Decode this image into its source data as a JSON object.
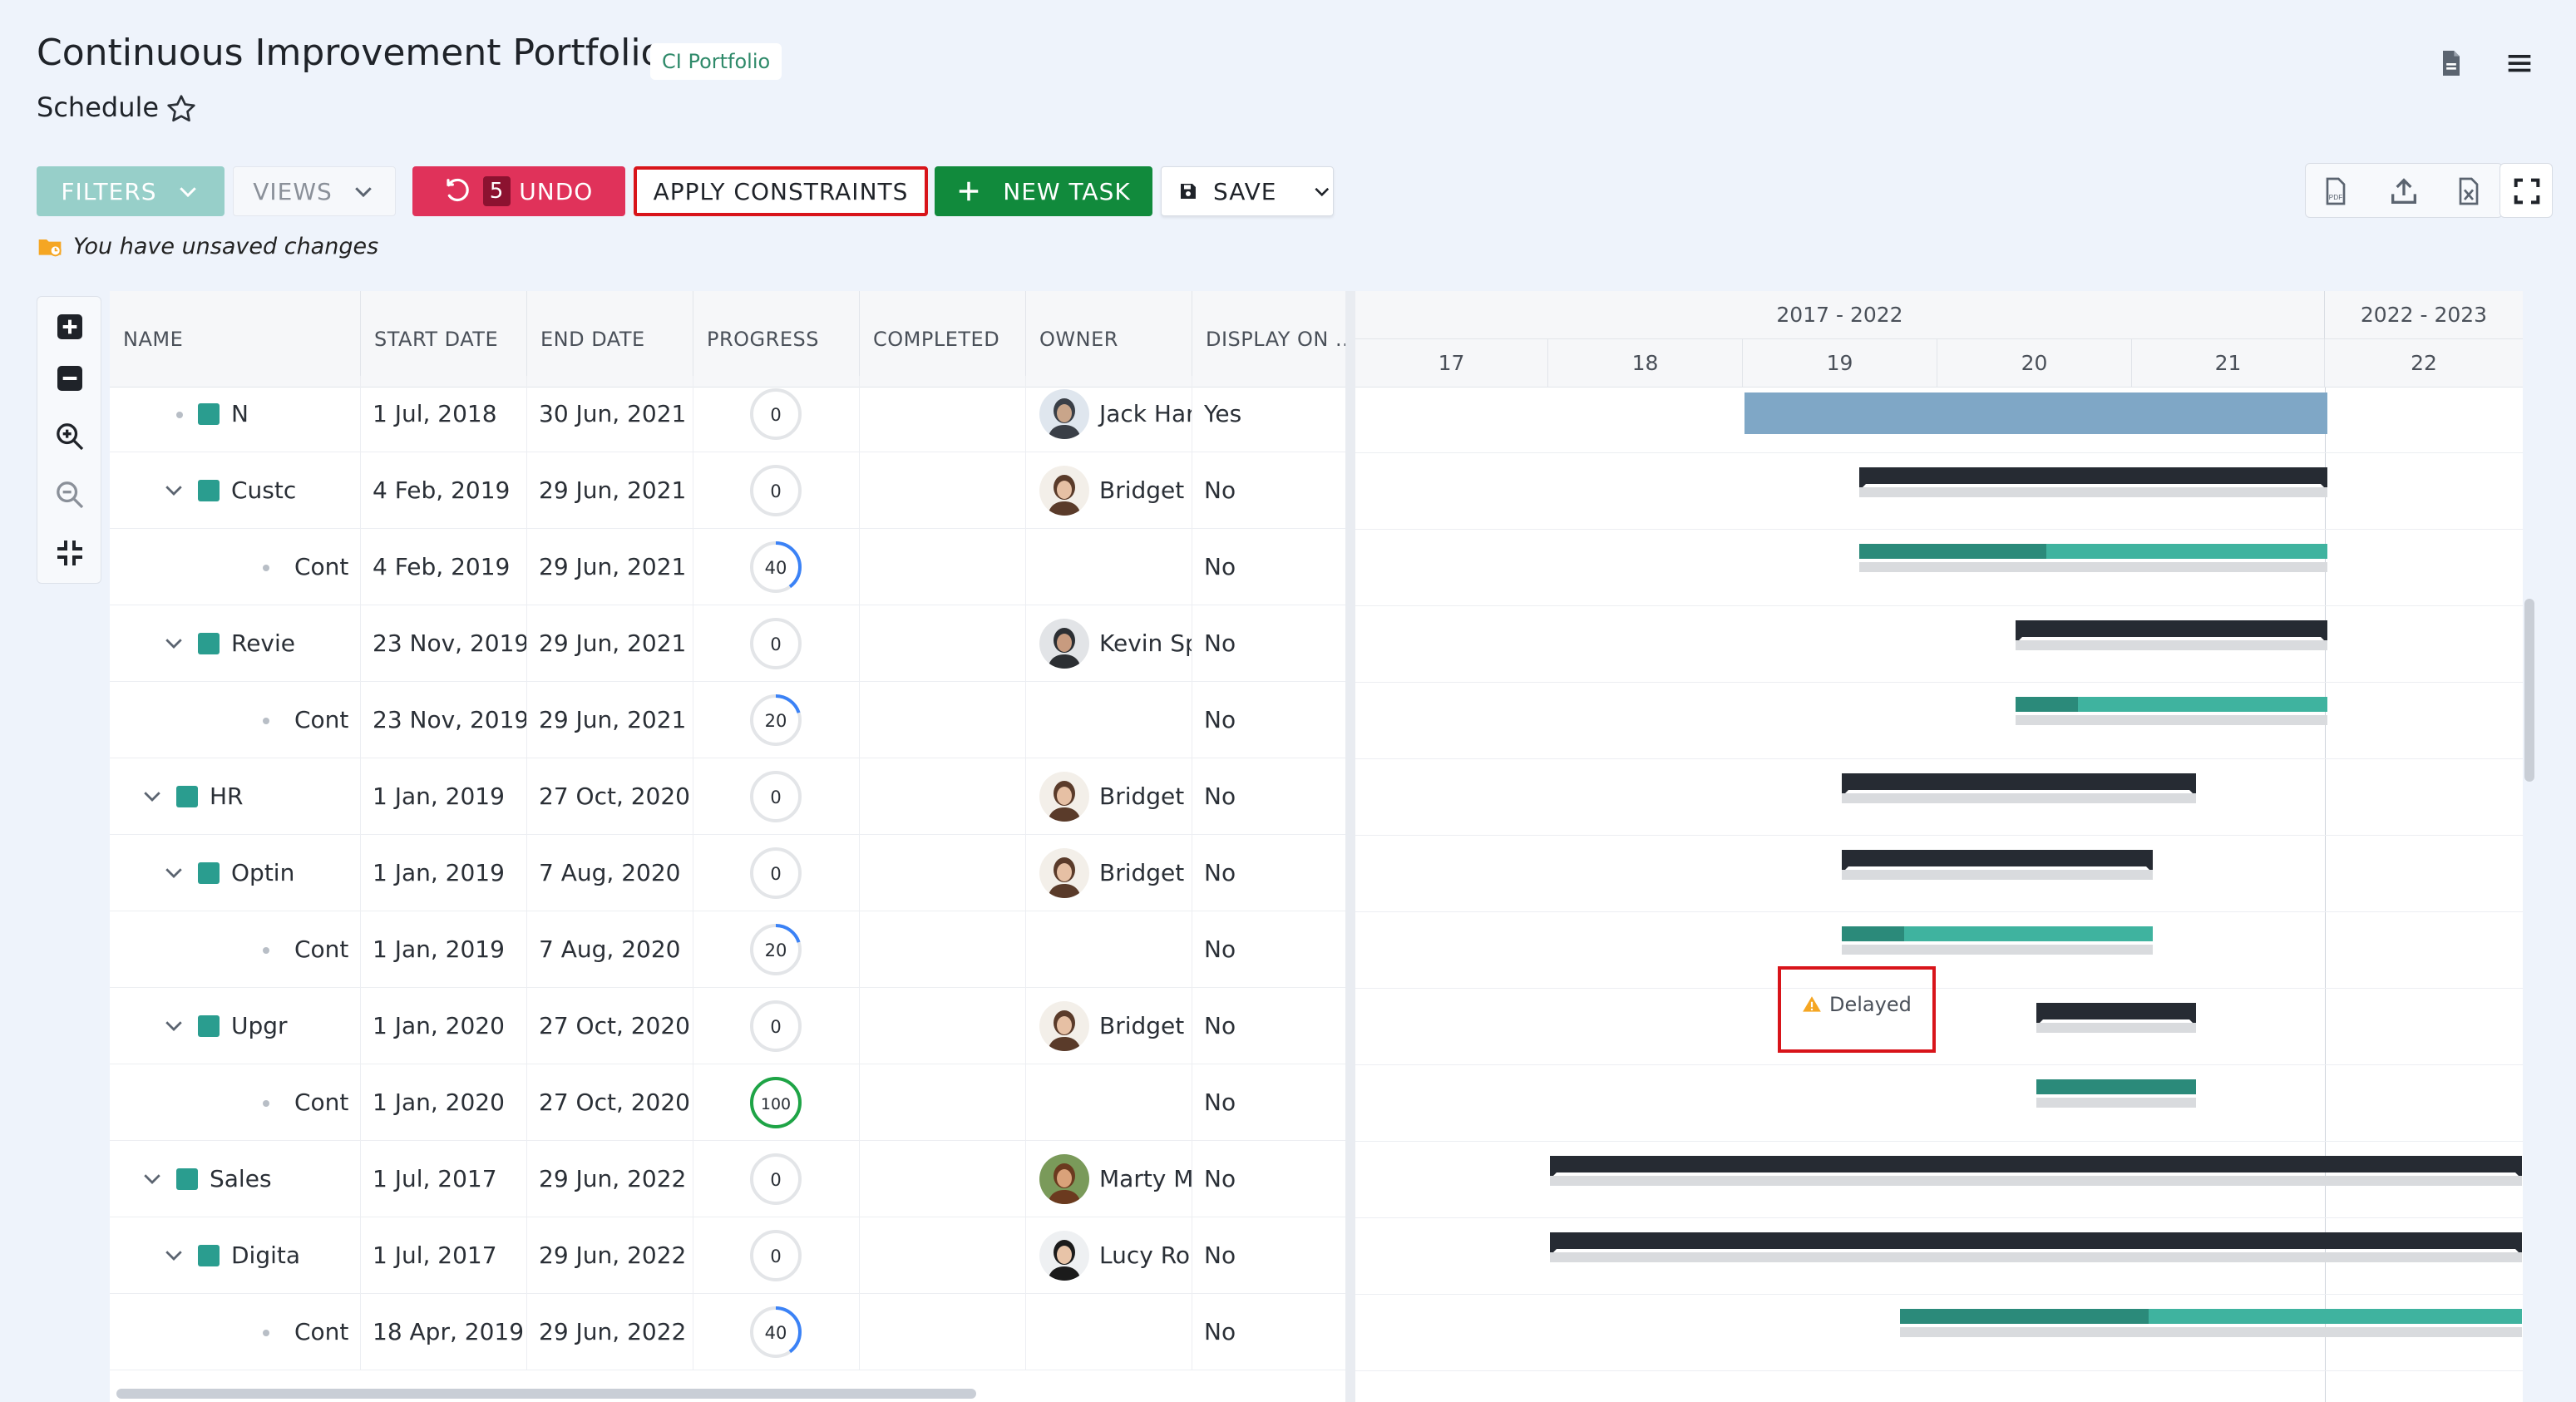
{
  "header": {
    "title": "Continuous Improvement Portfolio",
    "portfolio_badge": "CI Portfolio",
    "subtitle": "Schedule"
  },
  "toolbar": {
    "filters_label": "FILTERS",
    "views_label": "VIEWS",
    "undo_count": "5",
    "undo_label": "UNDO",
    "apply_constraints_label": "APPLY CONSTRAINTS",
    "new_task_label": "NEW TASK",
    "save_label": "SAVE",
    "unsaved_message": "You have unsaved changes"
  },
  "grid": {
    "columns": [
      "NAME",
      "START DATE",
      "END DATE",
      "PROGRESS",
      "COMPLETED",
      "OWNER",
      "DISPLAY ON ..."
    ],
    "rows": [
      {
        "level": 2,
        "expandable": false,
        "icon": true,
        "name": "N",
        "start": "1 Jul, 2018",
        "end": "30 Jun, 2021",
        "progress": 0,
        "owner": "Jack Harl",
        "display": "Yes"
      },
      {
        "level": 2,
        "expandable": true,
        "icon": true,
        "name": "Custc",
        "start": "4 Feb, 2019",
        "end": "29 Jun, 2021",
        "progress": 0,
        "owner": "Bridget E",
        "display": "No"
      },
      {
        "level": 3,
        "expandable": false,
        "icon": false,
        "name": "Cont",
        "start": "4 Feb, 2019",
        "end": "29 Jun, 2021",
        "progress": 40,
        "owner": "",
        "display": "No"
      },
      {
        "level": 2,
        "expandable": true,
        "icon": true,
        "name": "Revie",
        "start": "23 Nov, 2019",
        "end": "29 Jun, 2021",
        "progress": 0,
        "owner": "Kevin Sp",
        "display": "No"
      },
      {
        "level": 3,
        "expandable": false,
        "icon": false,
        "name": "Cont",
        "start": "23 Nov, 2019",
        "end": "29 Jun, 2021",
        "progress": 20,
        "owner": "",
        "display": "No"
      },
      {
        "level": 1,
        "expandable": true,
        "icon": true,
        "name": "HR",
        "start": "1 Jan, 2019",
        "end": "27 Oct, 2020",
        "progress": 0,
        "owner": "Bridget E",
        "display": "No"
      },
      {
        "level": 2,
        "expandable": true,
        "icon": true,
        "name": "Optin",
        "start": "1 Jan, 2019",
        "end": "7 Aug, 2020",
        "progress": 0,
        "owner": "Bridget E",
        "display": "No"
      },
      {
        "level": 3,
        "expandable": false,
        "icon": false,
        "name": "Cont",
        "start": "1 Jan, 2019",
        "end": "7 Aug, 2020",
        "progress": 20,
        "owner": "",
        "display": "No"
      },
      {
        "level": 2,
        "expandable": true,
        "icon": true,
        "name": "Upgr",
        "start": "1 Jan, 2020",
        "end": "27 Oct, 2020",
        "progress": 0,
        "owner": "Bridget E",
        "display": "No"
      },
      {
        "level": 3,
        "expandable": false,
        "icon": false,
        "name": "Cont",
        "start": "1 Jan, 2020",
        "end": "27 Oct, 2020",
        "progress": 100,
        "owner": "",
        "display": "No"
      },
      {
        "level": 1,
        "expandable": true,
        "icon": true,
        "name": "Sales",
        "start": "1 Jul, 2017",
        "end": "29 Jun, 2022",
        "progress": 0,
        "owner": "Marty M",
        "display": "No"
      },
      {
        "level": 2,
        "expandable": true,
        "icon": true,
        "name": "Digita",
        "start": "1 Jul, 2017",
        "end": "29 Jun, 2022",
        "progress": 0,
        "owner": "Lucy Ror",
        "display": "No"
      },
      {
        "level": 3,
        "expandable": false,
        "icon": false,
        "name": "Cont",
        "start": "18 Apr, 2019",
        "end": "29 Jun, 2022",
        "progress": 40,
        "owner": "",
        "display": "No"
      }
    ]
  },
  "gantt": {
    "period_labels": [
      "2017 - 2022",
      "2022 - 2023"
    ],
    "year_labels": [
      "17",
      "18",
      "19",
      "20",
      "21",
      "22"
    ],
    "delayed_label": "Delayed"
  },
  "colors": {
    "accent_teal": "#2a9d8f",
    "undo_red": "#e0325a",
    "new_task_green": "#118a3c",
    "highlight_red": "#d8141a",
    "summary_bar": "#262b33",
    "progress_blue": "#3b82f6",
    "progress_complete": "#1ea446"
  },
  "icons": {
    "header": [
      "pdf-document-icon",
      "hamburger-menu-icon"
    ],
    "toolbar_right": [
      "export-pdf-icon",
      "upload-icon",
      "export-excel-icon",
      "fullscreen-icon"
    ],
    "left_tools": [
      "expand-all-icon",
      "collapse-all-icon",
      "zoom-in-icon",
      "zoom-out-icon",
      "fit-to-screen-icon"
    ]
  }
}
